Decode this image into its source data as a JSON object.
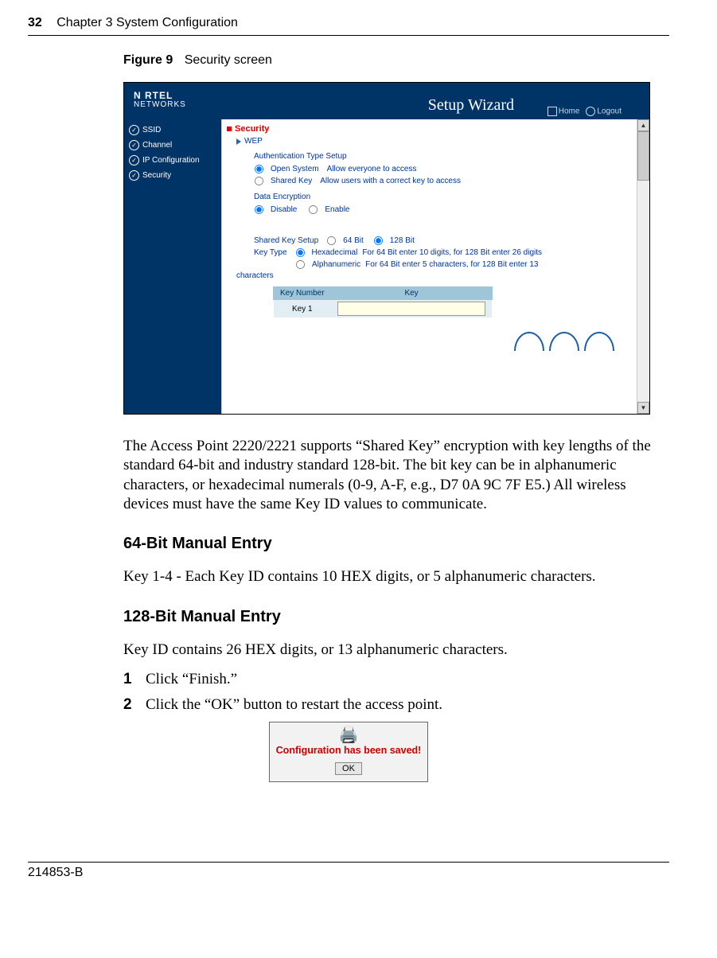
{
  "page": {
    "number": "32",
    "chapter": "Chapter 3  System Configuration",
    "doc_id": "214853-B"
  },
  "figure": {
    "label": "Figure 9",
    "caption": "Security screen"
  },
  "screenshot": {
    "brand_top": "N   RTEL",
    "brand_bottom": "NETWORKS",
    "wizard_title": "Setup Wizard",
    "links": {
      "home": "Home",
      "logout": "Logout"
    },
    "sidebar": {
      "items": [
        "SSID",
        "Channel",
        "IP Configuration",
        "Security"
      ]
    },
    "content": {
      "heading": "Security",
      "group": "WEP",
      "auth_heading": "Authentication Type Setup",
      "auth_options": [
        {
          "label": "Open System",
          "desc": "Allow everyone to access",
          "selected": true
        },
        {
          "label": "Shared Key",
          "desc": "Allow users with a correct key to access",
          "selected": false
        }
      ],
      "data_enc_heading": "Data Encryption",
      "data_enc_options": [
        {
          "label": "Disable",
          "selected": true
        },
        {
          "label": "Enable",
          "selected": false
        }
      ],
      "shared_key": {
        "label": "Shared Key Setup",
        "options": [
          {
            "label": "64 Bit",
            "selected": false
          },
          {
            "label": "128 Bit",
            "selected": true
          }
        ]
      },
      "key_type": {
        "label": "Key Type",
        "options": [
          {
            "label": "Hexadecimal",
            "desc": "For 64 Bit enter 10 digits, for 128 Bit enter 26 digits",
            "selected": true
          },
          {
            "label": "Alphanumeric",
            "desc": "For 64 Bit enter 5 characters, for 128 Bit enter 13",
            "selected": false
          }
        ],
        "wrap": "characters"
      },
      "table": {
        "headers": [
          "Key Number",
          "Key"
        ],
        "row_label": "Key 1",
        "value": ""
      }
    }
  },
  "body": {
    "p1": "The Access Point 2220/2221 supports “Shared Key” encryption with key lengths of the standard 64-bit and industry standard 128-bit. The bit key can be in alphanumeric characters, or hexadecimal numerals (0-9, A-F, e.g., D7 0A 9C 7F E5.) All wireless devices must have the same Key ID values to communicate.",
    "h64": "64-Bit Manual Entry",
    "p64": "Key 1-4 - Each Key ID contains 10 HEX digits, or 5 alphanumeric characters.",
    "h128": "128-Bit Manual Entry",
    "p128": "Key ID contains 26 HEX digits, or 13 alphanumeric characters.",
    "steps": [
      "Click “Finish.”",
      "Click the “OK” button to restart the access point."
    ],
    "confirm": {
      "text": "Configuration has been saved!",
      "button": "OK"
    }
  }
}
